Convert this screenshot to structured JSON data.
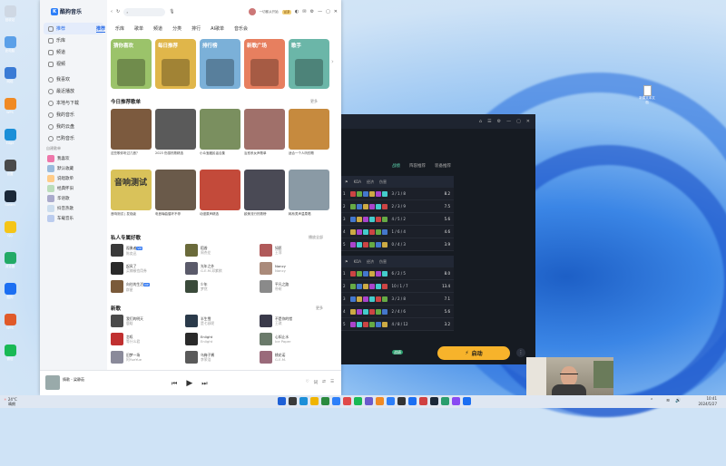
{
  "app": {
    "title": "酷狗音乐",
    "search_placeholder": "",
    "username": "一切都从开始",
    "vip_label": "VIP"
  },
  "sidebar": {
    "nav": [
      {
        "label": "推荐",
        "icon": "home-icon"
      },
      {
        "label": "乐库",
        "icon": "library-icon"
      },
      {
        "label": "频道",
        "icon": "channel-icon"
      },
      {
        "label": "视频",
        "icon": "video-icon"
      }
    ],
    "mine": [
      {
        "label": "我喜欢",
        "icon": "heart-icon"
      },
      {
        "label": "最近播放",
        "icon": "history-icon"
      },
      {
        "label": "本地与下载",
        "icon": "download-icon"
      },
      {
        "label": "我的音乐",
        "icon": "music-icon"
      },
      {
        "label": "我的云盘",
        "icon": "cloud-icon"
      },
      {
        "label": "已购音乐",
        "icon": "bag-icon"
      }
    ],
    "playlist_heading": "自建歌单",
    "playlists": [
      "我喜欢",
      "默认收藏",
      "说唱歌单",
      "经典怀旧",
      "华语歌",
      "抖音热歌",
      "车载音乐"
    ]
  },
  "tabs": [
    "推荐",
    "乐库",
    "歌单",
    "频道",
    "分类",
    "排行",
    "AI歌单",
    "音乐会"
  ],
  "featured": [
    {
      "title": "猜你喜欢",
      "color": "#9bc36a"
    },
    {
      "title": "每日推荐",
      "color": "#e0b64a"
    },
    {
      "title": "排行榜",
      "color": "#7bb0d8"
    },
    {
      "title": "新歌广场",
      "color": "#e77f5f"
    },
    {
      "title": "歌手",
      "color": "#6bb6a8"
    }
  ],
  "recommend": {
    "heading": "今日推荐歌单",
    "more": "更多",
    "row1": [
      {
        "caption": "这些歌你听过几首？",
        "color": "#7c5a3e"
      },
      {
        "caption": "2023 伤感热歌精选",
        "color": "#5a5a5a"
      },
      {
        "caption": "小众宝藏民谣合集",
        "color": "#7a8f5f"
      },
      {
        "caption": "治愈系女声歌单",
        "color": "#a0706a"
      },
      {
        "caption": "适合一个人听的歌",
        "color": "#c68a3e"
      }
    ],
    "row2": [
      {
        "caption": "音响测试 | 发烧级",
        "color": "#d9c25a",
        "art_text": "音响测试"
      },
      {
        "caption": "电音嗨曲循环不停",
        "color": "#6a5a4a"
      },
      {
        "caption": "动漫原声精选",
        "color": "#c34a3a"
      },
      {
        "caption": "欧美流行热歌榜",
        "color": "#4a4a55"
      },
      {
        "caption": "韩系男声温柔唱",
        "color": "#8a9aa5"
      }
    ]
  },
  "private_radio": {
    "heading": "私人专属好歌",
    "play_all": "播放全部",
    "songs": [
      {
        "title": "孤勇者",
        "artist": "陈奕迅",
        "color": "#3a3a3a",
        "tag": "VIP"
      },
      {
        "title": "稻香",
        "artist": "周杰伦",
        "color": "#6a6a3a"
      },
      {
        "title": "如愿",
        "artist": "王菲",
        "color": "#b05a5a"
      },
      {
        "title": "起风了",
        "artist": "买辣椒也用券",
        "color": "#2a2a2a"
      },
      {
        "title": "光年之外",
        "artist": "G.E.M.邓紫棋",
        "color": "#5a5a6a"
      },
      {
        "title": "Nancy",
        "artist": "Nancy",
        "color": "#aa8a7a"
      },
      {
        "title": "向往的生活",
        "artist": "群星",
        "color": "#7a5a3a",
        "tag": "VIP"
      },
      {
        "title": "少年",
        "artist": "梦然",
        "color": "#3a4a3a"
      },
      {
        "title": "平凡之路",
        "artist": "朴树",
        "color": "#8a8a8a"
      }
    ]
  },
  "new_songs": {
    "heading": "新歌",
    "more": "更多",
    "songs": [
      {
        "title": "我们的明天",
        "artist": "鹿晗",
        "color": "#4a4a4a"
      },
      {
        "title": "半生雪",
        "artist": "是七叔呢",
        "color": "#2a3a4a"
      },
      {
        "title": "不是你的错",
        "artist": "王琪",
        "color": "#3a3a4a"
      },
      {
        "title": "怎叹",
        "artist": "等什么君",
        "color": "#c03030"
      },
      {
        "title": "Enlight",
        "artist": "Enlight",
        "color": "#2a2a2a"
      },
      {
        "title": "心如止水",
        "artist": "Ice Paper",
        "color": "#6a7a6a"
      },
      {
        "title": "旧梦一场",
        "artist": "阿YueYue",
        "color": "#8a8a9a"
      },
      {
        "title": "乌梅子酱",
        "artist": "李荣浩",
        "color": "#5a5a5a"
      },
      {
        "title": "桃花诺",
        "artist": "G.E.M.",
        "color": "#9a6a7a"
      }
    ]
  },
  "player": {
    "title": "情歌 - 梁静茹",
    "prev": "⏮",
    "play": "▶",
    "next": "⏭",
    "right_controls": [
      "♡",
      "词",
      "⇄",
      "☰"
    ]
  },
  "game": {
    "title_icons": [
      "⌂",
      "☰",
      "⚙",
      "—",
      "▢",
      "✕"
    ],
    "tabs": [
      "战绩",
      "阵容推荐",
      "装备推荐"
    ],
    "rows_top": [
      {
        "rank": "1",
        "score": "8.2",
        "kda": "3 / 1 / 8"
      },
      {
        "rank": "2",
        "score": "7.5",
        "kda": "2 / 3 / 9"
      },
      {
        "rank": "3",
        "score": "5.6",
        "kda": "4 / 5 / 2"
      },
      {
        "rank": "4",
        "score": "4.6",
        "kda": "1 / 6 / 4"
      },
      {
        "rank": "5",
        "score": "3.9",
        "kda": "0 / 4 / 3"
      }
    ],
    "rows_bottom": [
      {
        "rank": "1",
        "score": "8.0",
        "kda": "6 / 2 / 5"
      },
      {
        "rank": "2",
        "score": "13.4",
        "kda": "10 / 1 / 7"
      },
      {
        "rank": "3",
        "score": "7.1",
        "kda": "3 / 2 / 8"
      },
      {
        "rank": "4",
        "score": "5.6",
        "kda": "2 / 4 / 6"
      },
      {
        "rank": "5",
        "score": "3.2",
        "kda": "4 / 8 / 12"
      }
    ],
    "toggle": "战绩",
    "start_button": "启动",
    "start_icon": "⚡"
  },
  "desktop": {
    "file_label": "新建文本文档",
    "icons": [
      "回收站",
      "此电脑",
      "网络",
      "WPS",
      "Edge",
      "设置",
      "Steam",
      "QQ",
      "浏览器",
      "酷狗",
      "WPS",
      "微信"
    ]
  },
  "taskbar": {
    "weather_temp": "24°C",
    "weather_desc": "晴朗",
    "time": "10:41",
    "date": "2024/5/27"
  },
  "colors": {
    "accent": "#2d6fe8",
    "game_bg": "#161b22",
    "start": "#f7b32b"
  }
}
